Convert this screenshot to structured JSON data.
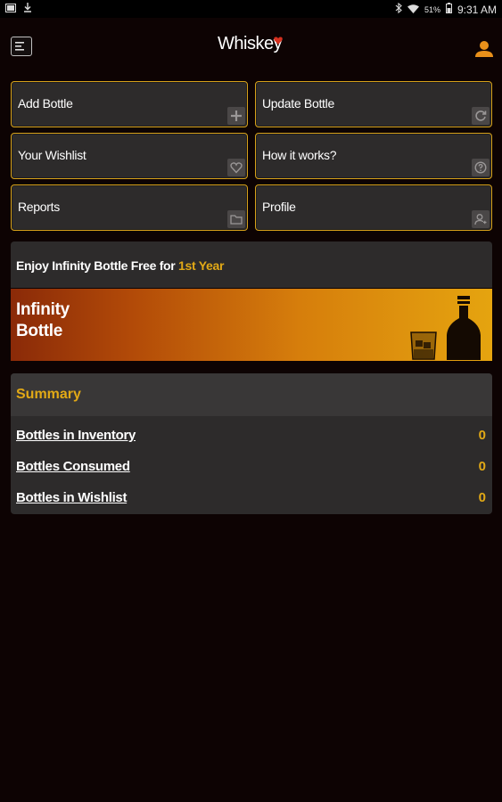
{
  "status_bar": {
    "battery_percent": "51%",
    "time": "9:31 AM"
  },
  "app": {
    "logo_text": "Whiskey"
  },
  "tiles": [
    {
      "label": "Add Bottle",
      "icon": "plus-icon"
    },
    {
      "label": "Update Bottle",
      "icon": "refresh-icon"
    },
    {
      "label": "Your Wishlist",
      "icon": "heart-icon"
    },
    {
      "label": "How it works?",
      "icon": "question-icon"
    },
    {
      "label": "Reports",
      "icon": "folder-icon"
    },
    {
      "label": "Profile",
      "icon": "user-icon"
    }
  ],
  "promo": {
    "text": "Enjoy Infinity Bottle Free for ",
    "highlight": "1st Year"
  },
  "banner": {
    "line1": "Infinity",
    "line2": "Bottle"
  },
  "summary": {
    "title": "Summary",
    "rows": [
      {
        "label": "Bottles in Inventory",
        "value": "0"
      },
      {
        "label": "Bottles Consumed",
        "value": "0"
      },
      {
        "label": "Bottles in Wishlist",
        "value": "0"
      }
    ]
  },
  "colors": {
    "accent": "#e2a916",
    "tile_bg": "#2d2b2b",
    "background": "#0d0303"
  }
}
